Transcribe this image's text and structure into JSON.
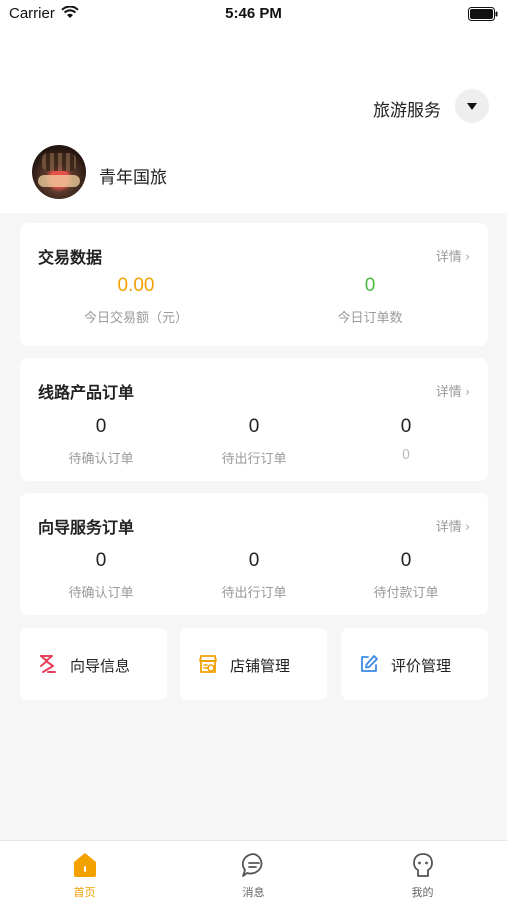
{
  "status_bar": {
    "carrier": "Carrier",
    "time": "5:46 PM"
  },
  "header": {
    "service_selector": "旅游服务",
    "merchant_name": "青年国旅"
  },
  "trade_card": {
    "title": "交易数据",
    "detail_link": "详情",
    "metrics": [
      {
        "value": "0.00",
        "label": "今日交易额（元）",
        "color": "#f2a100"
      },
      {
        "value": "0",
        "label": "今日订单数",
        "color": "#4cbb3f"
      }
    ]
  },
  "route_card": {
    "title": "线路产品订单",
    "detail_link": "详情",
    "metrics": [
      {
        "value": "0",
        "label": "待确认订单"
      },
      {
        "value": "0",
        "label": "待出行订单"
      },
      {
        "value": "0",
        "label": "0"
      }
    ]
  },
  "guide_card": {
    "title": "向导服务订单",
    "detail_link": "详情",
    "metrics": [
      {
        "value": "0",
        "label": "待确认订单"
      },
      {
        "value": "0",
        "label": "待出行订单"
      },
      {
        "value": "0",
        "label": "待付款订单"
      }
    ]
  },
  "quick_actions": [
    {
      "label": "向导信息",
      "icon": "guide-info-icon",
      "color": "#e8405a"
    },
    {
      "label": "店铺管理",
      "icon": "shop-icon",
      "color": "#f2a100"
    },
    {
      "label": "评价管理",
      "icon": "edit-icon",
      "color": "#3b8ae6"
    }
  ],
  "tab_bar": {
    "active_color": "#f2a100",
    "tabs": [
      {
        "label": "首页",
        "icon": "home-icon"
      },
      {
        "label": "消息",
        "icon": "message-icon"
      },
      {
        "label": "我的",
        "icon": "profile-icon"
      }
    ]
  }
}
